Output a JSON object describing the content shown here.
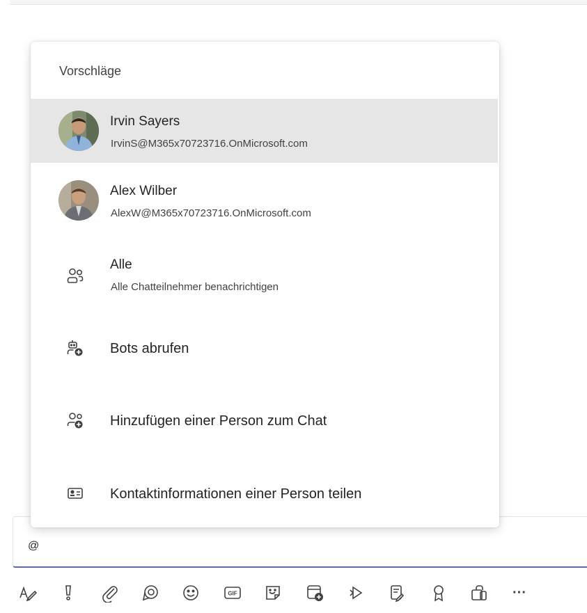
{
  "popup": {
    "title": "Vorschläge",
    "people": [
      {
        "name": "Irvin Sayers",
        "email": "IrvinS@M365x70723716.OnMicrosoft.com",
        "selected": true
      },
      {
        "name": "Alex Wilber",
        "email": "AlexW@M365x70723716.OnMicrosoft.com",
        "selected": false
      }
    ],
    "everyone": {
      "label": "Alle",
      "sub": "Alle Chatteilnehmer benachrichtigen",
      "icon": "people-icon"
    },
    "actions": [
      {
        "label": "Bots abrufen",
        "icon": "bot-add-icon"
      },
      {
        "label": "Hinzufügen einer Person zum Chat",
        "icon": "people-add-icon"
      },
      {
        "label": "Kontaktinformationen einer Person teilen",
        "icon": "contact-card-icon"
      }
    ]
  },
  "compose": {
    "text": "@"
  },
  "toolbar": {
    "buttons": [
      {
        "name": "format-icon"
      },
      {
        "name": "important-icon"
      },
      {
        "name": "attach-icon"
      },
      {
        "name": "loop-icon"
      },
      {
        "name": "emoji-icon"
      },
      {
        "name": "gif-icon",
        "label": "GIF"
      },
      {
        "name": "sticker-icon"
      },
      {
        "name": "schedule-meeting-icon"
      },
      {
        "name": "stream-icon"
      },
      {
        "name": "approvals-icon"
      },
      {
        "name": "praise-icon"
      },
      {
        "name": "apps-icon"
      },
      {
        "name": "more-options-icon",
        "label": "···"
      }
    ]
  },
  "colors": {
    "accent": "#6264a7",
    "selected_row": "#e6e6e6",
    "text": "#242424",
    "icon": "#424242"
  }
}
